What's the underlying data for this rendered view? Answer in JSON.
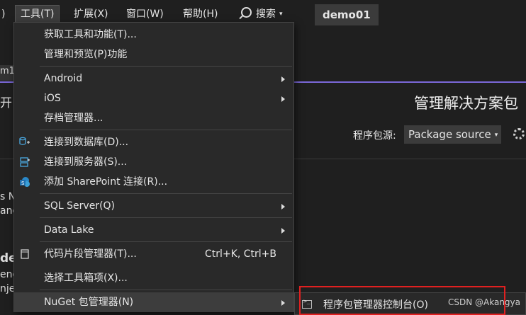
{
  "menubar": {
    "left_fragment": ")",
    "items": [
      "工具(T)",
      "扩展(X)",
      "窗口(W)",
      "帮助(H)"
    ],
    "search_label": "搜索",
    "solution_name": "demo01"
  },
  "background": {
    "tab_fragment": "m1",
    "left_frag_1": "开",
    "left_frag_2": "s N",
    "left_frag_3": "anc",
    "left_frag_4": "de",
    "left_frag_5": "enc",
    "left_frag_6": "nje",
    "package_manager_title": "管理解决方案包",
    "package_source_label": "程序包源:",
    "package_source_value": "Package source"
  },
  "tools_menu": {
    "items": [
      {
        "label": "获取工具和功能(T)..."
      },
      {
        "label": "管理和预览(P)功能"
      },
      {
        "label": "Android"
      },
      {
        "label": "iOS"
      },
      {
        "label": "存档管理器..."
      },
      {
        "label": "连接到数据库(D)..."
      },
      {
        "label": "连接到服务器(S)..."
      },
      {
        "label": "添加 SharePoint 连接(R)..."
      },
      {
        "label": "SQL Server(Q)"
      },
      {
        "label": "Data Lake"
      },
      {
        "label": "代码片段管理器(T)...",
        "shortcut": "Ctrl+K, Ctrl+B"
      },
      {
        "label": "选择工具箱项(X)..."
      },
      {
        "label": "NuGet 包管理器(N)"
      }
    ]
  },
  "submenu": {
    "label": "程序包管理器控制台(O)"
  },
  "watermark": "CSDN @Akangya",
  "colors": {
    "accent_line": "#7b68d9",
    "highlight_box": "#e02020"
  }
}
